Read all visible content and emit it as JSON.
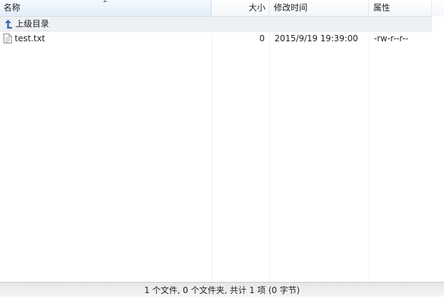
{
  "columns": {
    "name": "名称",
    "size": "大小",
    "mtime": "修改时间",
    "attr": "属性"
  },
  "parent_dir": {
    "label": "上级目录",
    "icon": "up-arrow-icon"
  },
  "files": [
    {
      "icon": "text-file-icon",
      "name": "test.txt",
      "size": "0",
      "mtime": "2015/9/19 19:39:00",
      "attr": "-rw-r--r--"
    }
  ],
  "status": {
    "text": "1 个文件, 0 个文件夹, 共计 1 项 (0 字节)"
  },
  "colors": {
    "header_bg": "#f3f6fa",
    "parent_row_bg": "#eef0f3",
    "icon_blue": "#2f6fb0"
  }
}
